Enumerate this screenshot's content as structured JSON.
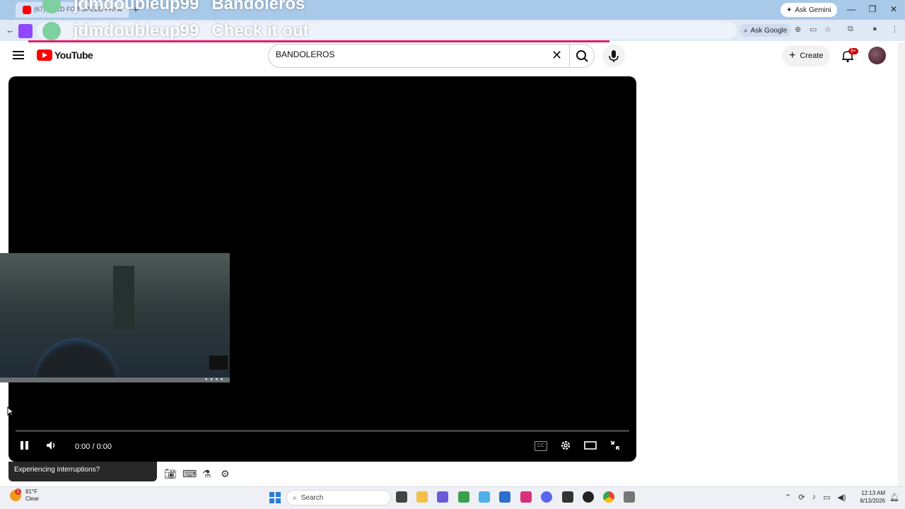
{
  "browser": {
    "tab_title": "(67) NEED FOR SPEED PROSTR...",
    "tab_close": "✕",
    "new_tab": "+",
    "ask_gemini": "Ask Gemini",
    "ask_google": "Ask Google",
    "window_minimize": "—",
    "window_restore": "❐",
    "window_close": "✕"
  },
  "overlay_chat": [
    {
      "user": "jdmdoubleup99",
      "message": "Bandoleros"
    },
    {
      "user": "jdmdoubleup99",
      "message": "Check it out"
    }
  ],
  "youtube": {
    "logo_text": "YouTube",
    "search_value": "BANDOLEROS",
    "create_label": "Create",
    "notification_badge": "9+"
  },
  "player": {
    "time": "0:00 / 0:00",
    "cc_label": "CC",
    "tooltip": "Experiencing interruptions?"
  },
  "taskbar": {
    "weather_temp": "81°F",
    "weather_desc": "Clear",
    "weather_badge": "1",
    "search_placeholder": "Search",
    "time": "12:13 AM",
    "date": "8/13/2026"
  }
}
